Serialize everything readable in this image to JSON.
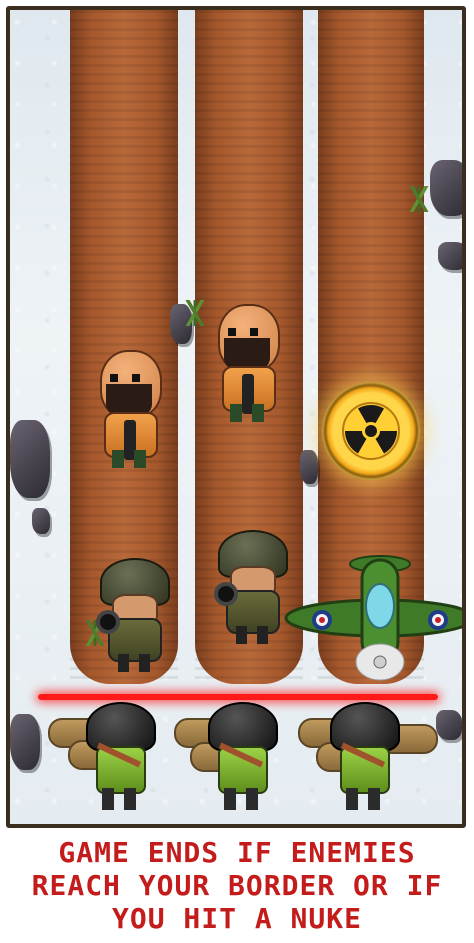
{
  "game": {
    "caption": "GAME ENDS IF ENEMIES REACH YOUR BORDER OR IF YOU HIT A NUKE",
    "caption_lines": [
      "GAME ENDS IF ENEMIES",
      "REACH YOUR BORDER OR IF",
      "YOU HIT A NUKE"
    ],
    "caption_color": "#c41b1b",
    "border_line_color": "#ff1a1a",
    "lanes": 3,
    "entities": {
      "enemies_bald": 2,
      "enemies_helmet": 2,
      "defenders": 3,
      "nuke_icon": "radiation-icon",
      "plane_icon": "fighter-plane-icon"
    }
  }
}
